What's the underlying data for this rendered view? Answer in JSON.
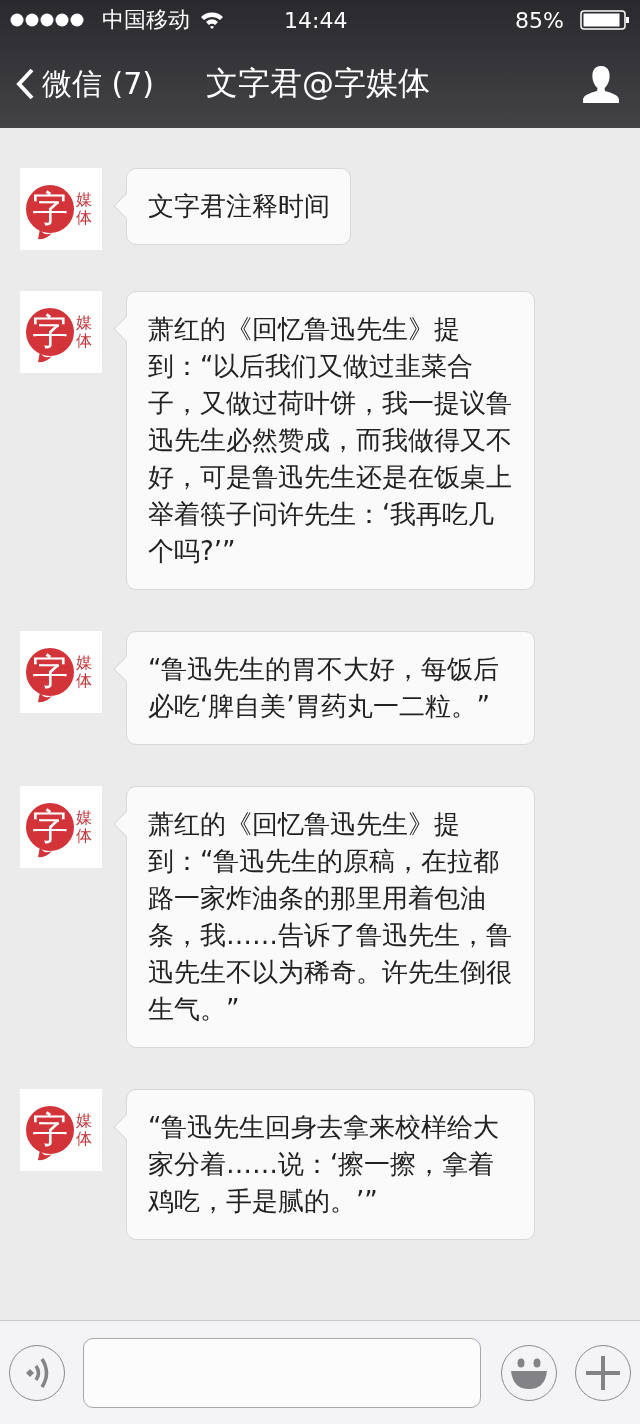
{
  "status_bar": {
    "carrier": "中国移动",
    "time": "14:44",
    "battery": "85%"
  },
  "nav": {
    "back": "微信 (7)",
    "title": "文字君@字媒体"
  },
  "messages": [
    {
      "avatar_main": "字",
      "avatar_side": "媒体",
      "text": "文字君注释时间"
    },
    {
      "avatar_main": "字",
      "avatar_side": "媒体",
      "text": "萧红的《回忆鲁迅先生》提到：“以后我们又做过韭菜合子，又做过荷叶饼，我一提议鲁迅先生必然赞成，而我做得又不好，可是鲁迅先生还是在饭桌上举着筷子问许先生：‘我再吃几个吗?’”"
    },
    {
      "avatar_main": "字",
      "avatar_side": "媒体",
      "text": "“鲁迅先生的胃不大好，每饭后必吃‘脾自美’胃药丸一二粒。”"
    },
    {
      "avatar_main": "字",
      "avatar_side": "媒体",
      "text": "萧红的《回忆鲁迅先生》提到：“鲁迅先生的原稿，在拉都路一家炸油条的那里用着包油条，我……告诉了鲁迅先生，鲁迅先生不以为稀奇。许先生倒很生气。”"
    },
    {
      "avatar_main": "字",
      "avatar_side": "媒体",
      "text": "“鲁迅先生回身去拿来校样给大家分着……说：‘擦一擦，拿着鸡吃，手是腻的。’”"
    }
  ]
}
